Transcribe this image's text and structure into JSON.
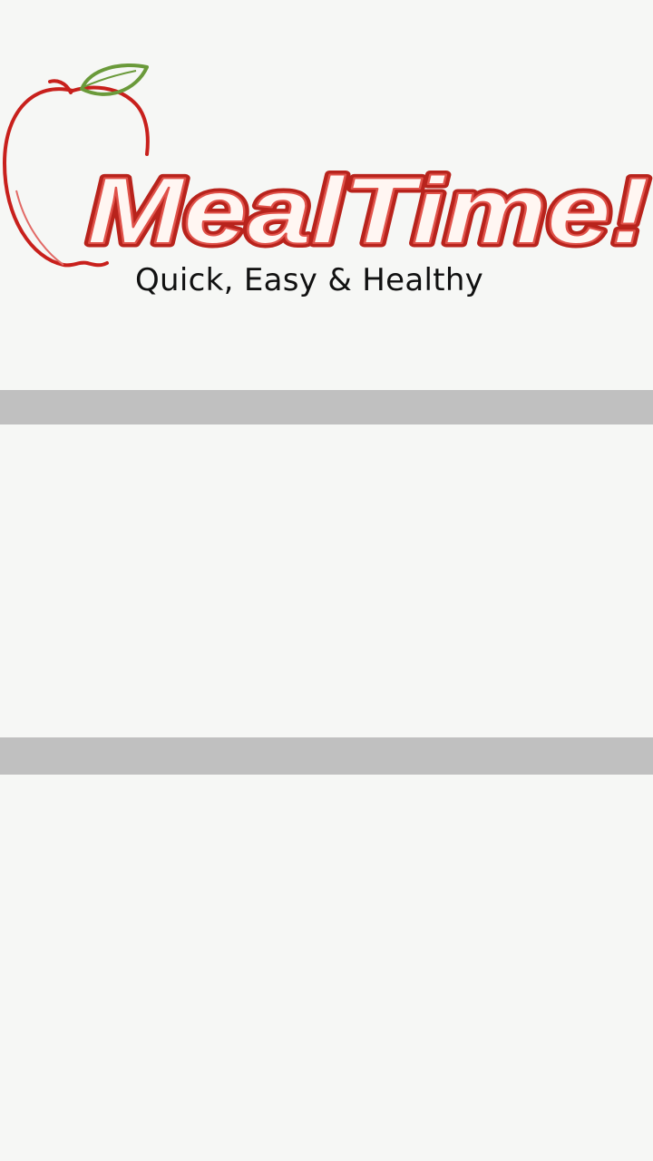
{
  "app": {
    "brand_name": "MealTime!",
    "tagline": "Quick, Easy & Healthy"
  },
  "colors": {
    "background": "#f6f7f5",
    "divider": "#c0c0c0",
    "brand_red": "#c8201c",
    "leaf_green": "#6a9a3a"
  }
}
